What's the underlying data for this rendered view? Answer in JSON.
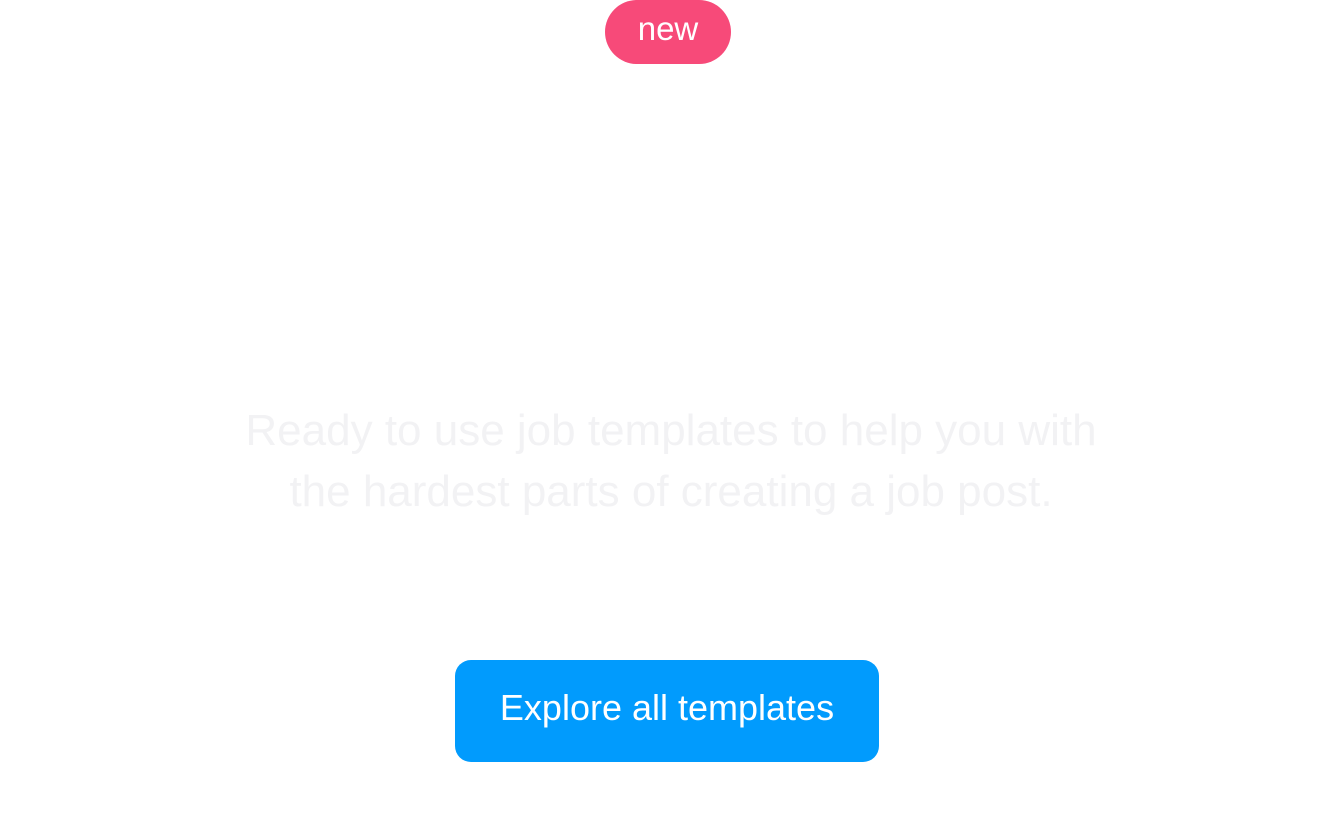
{
  "badge": {
    "label": "new",
    "color": "#f74a79"
  },
  "hero": {
    "line1": "Ready to use job templates to help you with",
    "line2": "the hardest parts of creating a job post.",
    "text_color": "#f2f2f4"
  },
  "cta": {
    "label": "Explore all templates",
    "color": "#019bfd"
  }
}
